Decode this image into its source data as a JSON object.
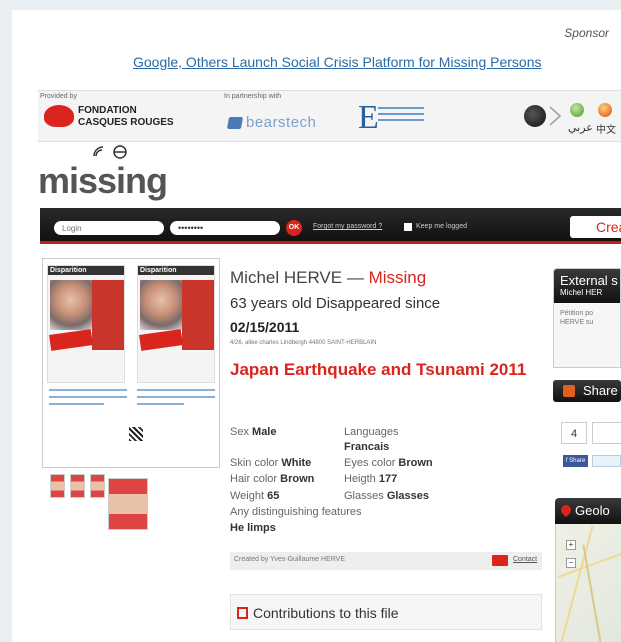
{
  "sponsor": {
    "label": "Sponsor",
    "link": "Google, Others Launch Social Crisis Platform for Missing Persons"
  },
  "partners": {
    "provided_by": "Provided by",
    "fondation_line1": "FONDATION",
    "fondation_line2": "CASQUES ROUGES",
    "partnership": "In partnership with",
    "bearstech": "bearstech",
    "languages": [
      "عربي",
      "中文"
    ]
  },
  "logo": "missing",
  "login": {
    "login_placeholder": "Login",
    "password_value": "••••••••",
    "ok_label": "OK",
    "forgot_label": "Forgot my password ?",
    "keep_label": "Keep me logged",
    "create_label": "Crea"
  },
  "poster": {
    "title": "Disparition"
  },
  "profile": {
    "name": "Michel HERVE —",
    "status": "Missing",
    "age_line": "63 years old Disappeared since",
    "date": "02/15/2011",
    "address": "4/26, allée charles Lindbergh 44800 SAINT-HERBLAIN",
    "event": "Japan Earthquake and Tsunami 2011",
    "sex_label": "Sex",
    "sex": "Male",
    "languages_label": "Languages",
    "languages": "Francais",
    "skin_label": "Skin color",
    "skin": "White",
    "eyes_label": "Eyes color",
    "eyes": "Brown",
    "hair_label": "Hair color",
    "hair": "Brown",
    "height_label": "Heigth",
    "height": "177",
    "weight_label": "Weight",
    "weight": "65",
    "glasses_label": "Glasses",
    "glasses": "Glasses",
    "features_label": "Any distinguishing features",
    "features": "He limps",
    "created_by": "Created by Yves-Guillaume HERVE",
    "contact_label": "Contact",
    "contributions_label": "Contributions to this file"
  },
  "right": {
    "external_title": "External s",
    "external_sub": "Michel HER",
    "petition_line1": "Pétition po",
    "petition_line2": "HERVE su",
    "share_label": "Share",
    "share_count": "4",
    "fb_label": "f Share",
    "geo_label": "Geolo"
  },
  "colors": {
    "accent_red": "#d9251d",
    "link_blue": "#2a6aa8",
    "dark_bar": "#111111"
  }
}
